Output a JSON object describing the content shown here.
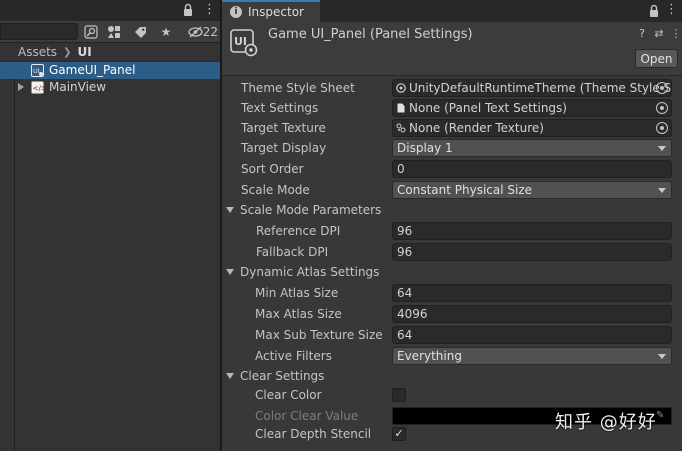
{
  "project": {
    "toolbar": {
      "hidden_count": "22"
    },
    "breadcrumb": [
      "Assets",
      "UI"
    ],
    "tree": [
      {
        "label": "GameUI_Panel",
        "selected": true,
        "icon": "panel-settings-icon"
      },
      {
        "label": "MainView",
        "selected": false,
        "icon": "uxml-icon",
        "expandable": true
      }
    ]
  },
  "inspector": {
    "tab_label": "Inspector",
    "asset_title": "Game UI_Panel (Panel Settings)",
    "open_button": "Open",
    "properties": {
      "theme_style_sheet": {
        "label": "Theme Style Sheet",
        "value": "UnityDefaultRuntimeTheme (Theme Style S"
      },
      "text_settings": {
        "label": "Text Settings",
        "value": "None (Panel Text Settings)"
      },
      "target_texture": {
        "label": "Target Texture",
        "value": "None (Render Texture)"
      },
      "target_display": {
        "label": "Target Display",
        "value": "Display 1"
      },
      "sort_order": {
        "label": "Sort Order",
        "value": "0"
      },
      "scale_mode": {
        "label": "Scale Mode",
        "value": "Constant Physical Size"
      },
      "scale_mode_parameters": {
        "label": "Scale Mode Parameters"
      },
      "reference_dpi": {
        "label": "Reference DPI",
        "value": "96"
      },
      "fallback_dpi": {
        "label": "Fallback DPI",
        "value": "96"
      },
      "dynamic_atlas_settings": {
        "label": "Dynamic Atlas Settings"
      },
      "min_atlas_size": {
        "label": "Min Atlas Size",
        "value": "64"
      },
      "max_atlas_size": {
        "label": "Max Atlas Size",
        "value": "4096"
      },
      "max_sub_texture_size": {
        "label": "Max Sub Texture Size",
        "value": "64"
      },
      "active_filters": {
        "label": "Active Filters",
        "value": "Everything"
      },
      "clear_settings": {
        "label": "Clear Settings"
      },
      "clear_color": {
        "label": "Clear Color",
        "checked": false
      },
      "color_clear_value": {
        "label": "Color Clear Value",
        "color": "#000000"
      },
      "clear_depth_stencil": {
        "label": "Clear Depth Stencil",
        "checked": true,
        "check_glyph": "✓"
      }
    }
  },
  "watermark": "知乎 @好好",
  "colors": {
    "selection": "#2c5d87",
    "tab_accent": "#3a79bb",
    "panel_bg": "#383838"
  }
}
